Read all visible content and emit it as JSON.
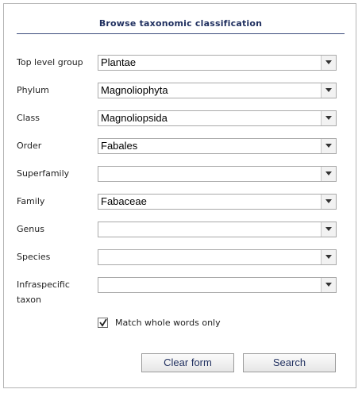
{
  "form": {
    "title": "Browse taxonomic classification",
    "fields": [
      {
        "label": "Top level group",
        "value": "Plantae"
      },
      {
        "label": "Phylum",
        "value": "Magnoliophyta"
      },
      {
        "label": "Class",
        "value": "Magnoliopsida"
      },
      {
        "label": "Order",
        "value": "Fabales"
      },
      {
        "label": "Superfamily",
        "value": ""
      },
      {
        "label": "Family",
        "value": "Fabaceae"
      },
      {
        "label": "Genus",
        "value": ""
      },
      {
        "label": "Species",
        "value": ""
      },
      {
        "label": "Infraspecific",
        "label_line2": "taxon",
        "value": ""
      }
    ],
    "match_whole_words": {
      "label": "Match whole words only",
      "checked": true
    },
    "buttons": {
      "clear": "Clear form",
      "search": "Search"
    }
  },
  "icons": {
    "dropdown": "chevron-down-icon",
    "checkbox": "check-icon"
  },
  "colors": {
    "title": "#1f2f5f",
    "rule": "#3c4c7c",
    "border": "#b4b4b4"
  }
}
